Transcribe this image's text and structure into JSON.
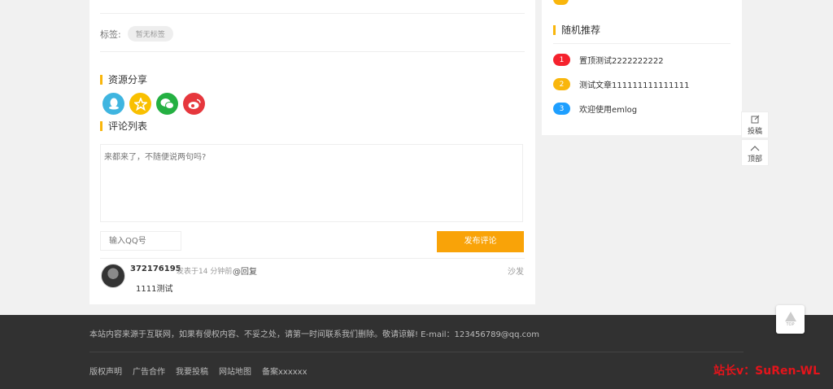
{
  "article": {
    "tags_label": "标签:",
    "tag_empty": "暂无标签",
    "share_title": "资源分享",
    "share_icons": [
      "qq-icon",
      "qzone-icon",
      "wechat-icon",
      "weibo-icon"
    ],
    "comments_title": "评论列表",
    "comment_placeholder": "来都来了，不随便说两句吗?",
    "qq_placeholder": "输入QQ号",
    "submit_label": "发布评论",
    "comment": {
      "name": "372176195",
      "time": "发表于14 分钟前",
      "reply": "@回复",
      "floor": "沙发",
      "text": "1111测试"
    }
  },
  "sidebar": {
    "random_title": "随机推荐",
    "items": [
      {
        "num": "1",
        "title": "置顶测试2222222222",
        "color": "#f5222d"
      },
      {
        "num": "2",
        "title": "测试文章111111111111111",
        "color": "#f9b60c"
      },
      {
        "num": "3",
        "title": "欢迎使用emlog",
        "color": "#1e9fff"
      }
    ]
  },
  "float": {
    "post_label": "投稿",
    "top_label": "顶部"
  },
  "footer": {
    "notice": "本站内容来源于互联网，如果有侵权内容、不妥之处，请第一时间联系我们删除。敬请谅解! E-mail：123456789@qq.com",
    "links": [
      "版权声明",
      "广告合作",
      "我要投稿",
      "网站地图",
      "备案xxxxxx"
    ],
    "brand": "站长v：SuRen-WL",
    "totop_label": "TOP"
  }
}
